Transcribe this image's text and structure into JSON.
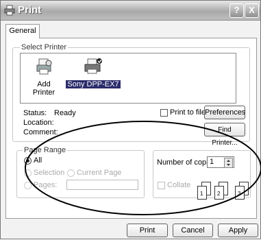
{
  "window": {
    "title": "Print",
    "help_btn": "?",
    "close_btn": "X"
  },
  "tabs": [
    {
      "label": "General"
    }
  ],
  "select_printer": {
    "legend": "Select Printer",
    "items": [
      {
        "label": "Add Printer",
        "icon": "add-printer-icon"
      },
      {
        "label": "Sony DPP-EX7",
        "icon": "printer-icon",
        "selected": true
      }
    ],
    "status_label": "Status:",
    "status_value": "Ready",
    "location_label": "Location:",
    "comment_label": "Comment:",
    "print_to_file": {
      "label": "Print to file",
      "checked": false
    },
    "preferences_btn": "Preferences",
    "find_printer_btn": "Find Printer..."
  },
  "page_range": {
    "legend": "Page Range",
    "options": [
      {
        "label": "All",
        "selected": true,
        "enabled": true
      },
      {
        "label": "Selection",
        "selected": false,
        "enabled": false
      },
      {
        "label": "Current Page",
        "selected": false,
        "enabled": false
      },
      {
        "label": "Pages:",
        "selected": false,
        "enabled": false
      }
    ],
    "pages_value": ""
  },
  "copies": {
    "label": "Number of copies:",
    "value": "1",
    "collate": {
      "label": "Collate",
      "checked": false,
      "enabled": false
    },
    "collate_pages": [
      "1",
      "1",
      "2",
      "2",
      "3",
      "3"
    ]
  },
  "buttons": {
    "print": "Print",
    "cancel": "Cancel",
    "apply": "Apply"
  },
  "colors": {
    "selection": "#2b2b6b",
    "annotation": "#000000"
  }
}
